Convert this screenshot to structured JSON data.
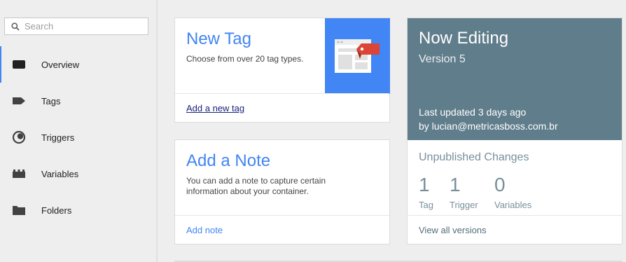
{
  "search": {
    "placeholder": "Search"
  },
  "sidebar": {
    "items": [
      {
        "label": "Overview",
        "icon": "overview-icon",
        "active": true
      },
      {
        "label": "Tags",
        "icon": "tag-icon"
      },
      {
        "label": "Triggers",
        "icon": "trigger-icon"
      },
      {
        "label": "Variables",
        "icon": "variables-icon"
      },
      {
        "label": "Folders",
        "icon": "folder-icon"
      }
    ]
  },
  "new_tag": {
    "title": "New Tag",
    "description": "Choose from over 20 tag types.",
    "link": "Add a new tag",
    "illustration": "tag-browser-illustration"
  },
  "note": {
    "title": "Add a Note",
    "description": "You can add a note to capture certain information about your container.",
    "link": "Add note"
  },
  "editing": {
    "title": "Now Editing",
    "version": "Version 5",
    "updated": "Last updated 3 days ago",
    "by": "by lucian@metricasboss.com.br",
    "unpublished_title": "Unpublished Changes",
    "stats": [
      {
        "value": "1",
        "label": "Tag"
      },
      {
        "value": "1",
        "label": "Trigger"
      },
      {
        "value": "0",
        "label": "Variables"
      }
    ],
    "link": "View all versions"
  },
  "colors": {
    "accent": "#4285f4",
    "editing_bg": "#607d8b",
    "tag_red": "#db4437"
  }
}
